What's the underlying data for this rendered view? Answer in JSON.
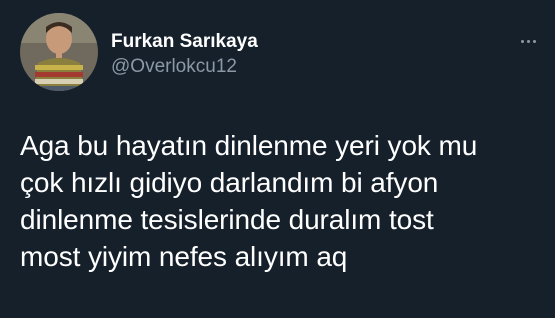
{
  "tweet": {
    "author": {
      "display_name": "Furkan Sarıkaya",
      "handle": "@Overlokcu12",
      "avatar_icon": "profile-photo"
    },
    "more_icon": "more-horizontal-icon",
    "text": "Aga bu hayatın dinlenme yeri yok mu\nçok hızlı gidiyo darlandım bi afyon\ndinlenme tesislerinde duralım tost\nmost yiyim nefes alıyım aq"
  },
  "colors": {
    "background": "#15202b",
    "primary_text": "#ffffff",
    "secondary_text": "#8b98a5"
  }
}
